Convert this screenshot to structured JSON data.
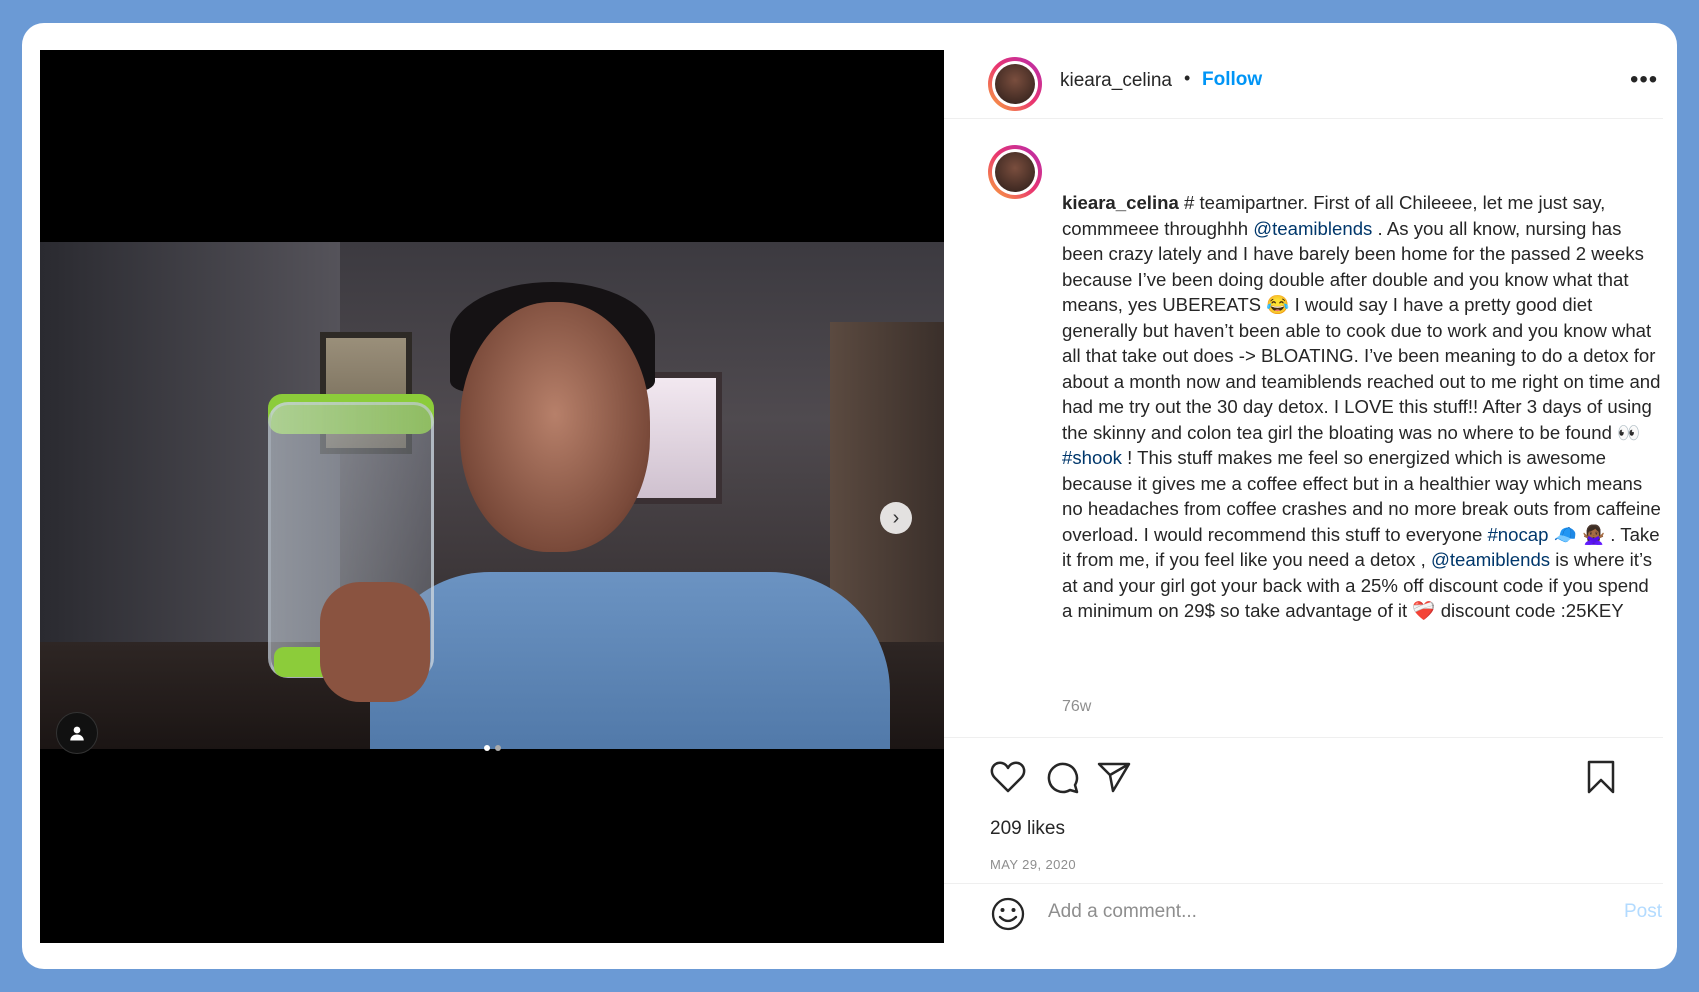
{
  "post": {
    "username": "kieara_celina",
    "separator": "•",
    "follow_label": "Follow",
    "more_label": "•••",
    "caption_parts": [
      {
        "text": "kieara_celina",
        "cls": "u"
      },
      {
        "text": " # teamipartner. First of all Chileeee, let me just say, commmeee throughhh ",
        "cls": ""
      },
      {
        "text": "@teamiblends",
        "cls": "tag"
      },
      {
        "text": " . As you all know, nursing has been crazy lately and I have barely been home for the passed 2 weeks because I’ve been doing double after double and you know what that means, yes UBEREATS 😂 I would say I have a pretty good diet generally but haven’t been able to cook due to work and you know what all that take out does -> BLOATING. I’ve been meaning to do a detox for about a month now and teamiblends reached out to me right on time and had me try out the 30 day detox. I LOVE this stuff!! After 3 days of using the skinny and colon tea girl the bloating was no where to be found 👀 ",
        "cls": ""
      },
      {
        "text": "#shook",
        "cls": "tag"
      },
      {
        "text": " ! This stuff makes me feel so energized which is awesome because it gives me a coffee effect but in a healthier way which means no headaches from coffee crashes and no more break outs from caffeine overload. I would recommend this stuff to everyone ",
        "cls": ""
      },
      {
        "text": "#nocap",
        "cls": "tag"
      },
      {
        "text": " 🧢 🙅🏾‍♀️ . Take it from me, if you feel like you need a detox , ",
        "cls": ""
      },
      {
        "text": "@teamiblends",
        "cls": "tag"
      },
      {
        "text": " is where it’s at and your girl got your back with a 25% off discount code if you spend a minimum on 29$ so take advantage of it ❤️‍🩹 discount code :25KEY",
        "cls": ""
      }
    ],
    "timestamp": "76w",
    "likes": "209 likes",
    "date": "MAY 29, 2020",
    "comment_placeholder": "Add a comment...",
    "post_label": "Post",
    "next_arrow": "›",
    "carousel_count": 2,
    "carousel_current": 1
  },
  "icons": {
    "like": "heart-icon",
    "comment": "comment-icon",
    "share": "share-icon",
    "save": "bookmark-icon",
    "emoji": "smiley-icon",
    "user_tag": "user-tag-icon"
  },
  "colors": {
    "frame": "#6b9ad5",
    "link": "#0095f6",
    "hashtag": "#00376b",
    "muted": "#8e8e8e"
  }
}
